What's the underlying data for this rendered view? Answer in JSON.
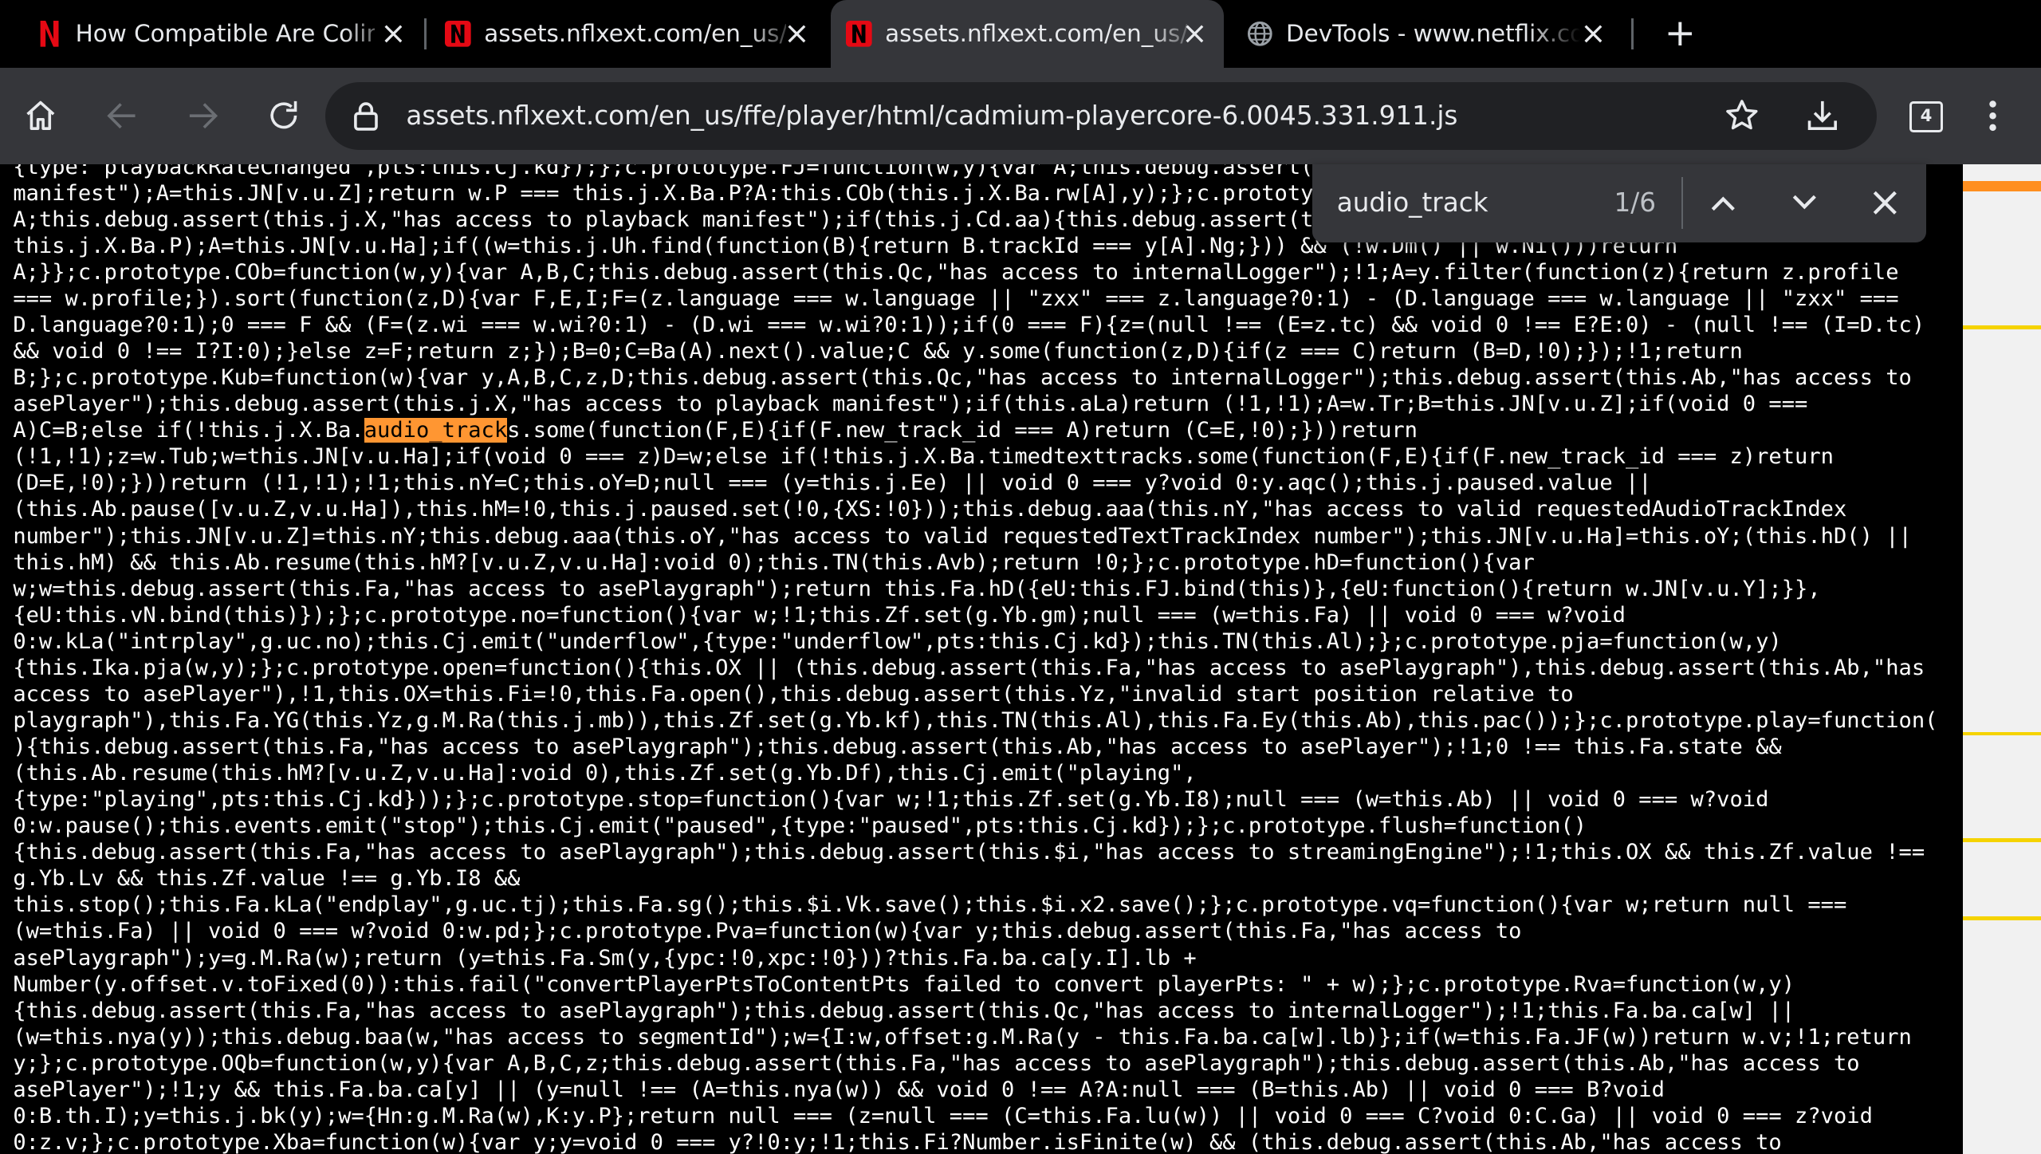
{
  "browser": {
    "tabs": [
      {
        "title": "How Compatible Are Colin Br",
        "favicon": "netflix-n-icon",
        "active": false
      },
      {
        "title": "assets.nflxext.com/en_us/ffe",
        "favicon": "netflix-n-icon",
        "active": false
      },
      {
        "title": "assets.nflxext.com/en_us/ffe",
        "favicon": "netflix-n-icon",
        "active": true
      },
      {
        "title": "DevTools - www.netflix.com/",
        "favicon": "globe-icon",
        "active": false
      }
    ],
    "address": {
      "url": "assets.nflxext.com/en_us/ffe/player/html/cadmium-playercore-6.0045.331.911.js"
    },
    "tab_count": "4",
    "colors": {
      "chrome_bg": "#000000",
      "toolbar_bg": "#35363a",
      "omnibox_bg": "#202124",
      "highlight": "#ff9632",
      "netflix_red": "#e50914"
    }
  },
  "find_bar": {
    "query": "audio_track",
    "count": "1/6"
  },
  "code": {
    "lines": [
      "{type:\"playbackRateChanged\",pts:this.Cj.kd});};c.prototype.FJ=function(w,y){var A;this.debug.assert(this.Qc,\"has access to",
      "manifest\");A=this.JN[v.u.Z];return w.P === this.j.X.Ba.P?A:this.COb(this.j.X.Ba.rw[A],y);};c.prototype.COb=function(w,y){",
      "A;this.debug.assert(this.j.X,\"has access to playback manifest\");if(this.j.Cd.aa){this.debug.assert(this.Ab,\"has access to asePlayer\");",
      "this.j.X.Ba.P);A=this.JN[v.u.Ha];if((w=this.j.Uh.find(function(B){return B.trackId === y[A].Ng;})) && (!w.Dm() || w.Ni()))return",
      "A;}};c.prototype.COb=function(w,y){var A,B,C;this.debug.assert(this.Qc,\"has access to internalLogger\");!1;A=y.filter(function(z){return z.profile",
      "=== w.profile;}).sort(function(z,D){var F,E,I;F=(z.language === w.language || \"zxx\" === z.language?0:1) - (D.language === w.language || \"zxx\" ===",
      "D.language?0:1);0 === F && (F=(z.wi === w.wi?0:1) - (D.wi === w.wi?0:1));if(0 === F){z=(null !== (E=z.tc) && void 0 !== E?E:0) - (null !== (I=D.tc)",
      "&& void 0 !== I?I:0);}else z=F;return z;});B=0;C=Ba(A).next().value;C && y.some(function(z,D){if(z === C)return (B=D,!0);});!1;return",
      "B;};c.prototype.Kub=function(w){var y,A,B,C,z,D;this.debug.assert(this.Qc,\"has access to internalLogger\");this.debug.assert(this.Ab,\"has access to",
      "asePlayer\");this.debug.assert(this.j.X,\"has access to playback manifest\");if(this.aLa)return (!1,!1);A=w.Tr;B=this.JN[v.u.Z];if(void 0 ===",
      "A)C=B;else if(!this.j.X.Ba.audio_tracks.some(function(F,E){if(F.new_track_id === A)return (C=E,!0);}))return",
      "(!1,!1);z=w.Tub;w=this.JN[v.u.Ha];if(void 0 === z)D=w;else if(!this.j.X.Ba.timedtexttracks.some(function(F,E){if(F.new_track_id === z)return",
      "(D=E,!0);}))return (!1,!1);!1;this.nY=C;this.oY=D;null === (y=this.j.Ee) || void 0 === y?void 0:y.aqc();this.j.paused.value ||",
      "(this.Ab.pause([v.u.Z,v.u.Ha]),this.hM=!0,this.j.paused.set(!0,{XS:!0}));this.debug.aaa(this.nY,\"has access to valid requestedAudioTrackIndex",
      "number\");this.JN[v.u.Z]=this.nY;this.debug.aaa(this.oY,\"has access to valid requestedTextTrackIndex number\");this.JN[v.u.Ha]=this.oY;(this.hD() ||",
      "this.hM) && this.Ab.resume(this.hM?[v.u.Z,v.u.Ha]:void 0);this.TN(this.Avb);return !0;};c.prototype.hD=function(){var",
      "w;w=this.debug.assert(this.Fa,\"has access to asePlaygraph\");return this.Fa.hD({eU:this.FJ.bind(this)},{eU:function(){return w.JN[v.u.Y];}},",
      "{eU:this.vN.bind(this)});};c.prototype.no=function(){var w;!1;this.Zf.set(g.Yb.gm);null === (w=this.Fa) || void 0 === w?void",
      "0:w.kLa(\"intrplay\",g.uc.no);this.Cj.emit(\"underflow\",{type:\"underflow\",pts:this.Cj.kd});this.TN(this.Al);};c.prototype.pja=function(w,y)",
      "{this.Ika.pja(w,y);};c.prototype.open=function(){this.OX || (this.debug.assert(this.Fa,\"has access to asePlaygraph\"),this.debug.assert(this.Ab,\"has",
      "access to asePlayer\"),!1,this.OX=this.Fi=!0,this.Fa.open(),this.debug.assert(this.Yz,\"invalid start position relative to",
      "playgraph\"),this.Fa.YG(this.Yz,g.M.Ra(this.j.mb)),this.Zf.set(g.Yb.kf),this.TN(this.Al),this.Fa.Ey(this.Ab),this.pac());};c.prototype.play=function(",
      "){this.debug.assert(this.Fa,\"has access to asePlaygraph\");this.debug.assert(this.Ab,\"has access to asePlayer\");!1;0 !== this.Fa.state &&",
      "(this.Ab.resume(this.hM?[v.u.Z,v.u.Ha]:void 0),this.Zf.set(g.Yb.Df),this.Cj.emit(\"playing\",",
      "{type:\"playing\",pts:this.Cj.kd}));};c.prototype.stop=function(){var w;!1;this.Zf.set(g.Yb.I8);null === (w=this.Ab) || void 0 === w?void",
      "0:w.pause();this.events.emit(\"stop\");this.Cj.emit(\"paused\",{type:\"paused\",pts:this.Cj.kd});};c.prototype.flush=function()",
      "{this.debug.assert(this.Fa,\"has access to asePlaygraph\");this.debug.assert(this.$i,\"has access to streamingEngine\");!1;this.OX && this.Zf.value !==",
      "g.Yb.Lv && this.Zf.value !== g.Yb.I8 &&",
      "this.stop();this.Fa.kLa(\"endplay\",g.uc.tj);this.Fa.sg();this.$i.Vk.save();this.$i.x2.save();};c.prototype.vq=function(){var w;return null ===",
      "(w=this.Fa) || void 0 === w?void 0:w.pd;};c.prototype.Pva=function(w){var y;this.debug.assert(this.Fa,\"has access to",
      "asePlaygraph\");y=g.M.Ra(w);return (y=this.Fa.Sm(y,{ypc:!0,xpc:!0}))?this.Fa.ba.ca[y.I].lb +",
      "Number(y.offset.v.toFixed(0)):this.fail(\"convertPlayerPtsToContentPts failed to convert playerPts: \" + w);};c.prototype.Rva=function(w,y)",
      "{this.debug.assert(this.Fa,\"has access to asePlaygraph\");this.debug.assert(this.Qc,\"has access to internalLogger\");!1;this.Fa.ba.ca[w] ||",
      "(w=this.nya(y));this.debug.baa(w,\"has access to segmentId\");w={I:w,offset:g.M.Ra(y - this.Fa.ba.ca[w].lb)};if(w=this.Fa.JF(w))return w.v;!1;return",
      "y;};c.prototype.OQb=function(w,y){var A,B,C,z;this.debug.assert(this.Fa,\"has access to asePlaygraph\");this.debug.assert(this.Ab,\"has access to",
      "asePlayer\");!1;y && this.Fa.ba.ca[y] || (y=null !== (A=this.nya(w)) && void 0 !== A?A:null === (B=this.Ab) || void 0 === B?void",
      "0:B.th.I);y=this.j.bk(y);w={Hn:g.M.Ra(w),K:y.P};return null === (z=null === (C=this.Fa.lu(w)) || void 0 === C?void 0:C.Ga) || void 0 === z?void",
      "0:z.v;};c.prototype.Xba=function(w){var y;y=void 0 === y?!0:y;!1;this.Fi?Number.isFinite(w) && (this.debug.assert(this.Ab,\"has access to"
    ]
  }
}
